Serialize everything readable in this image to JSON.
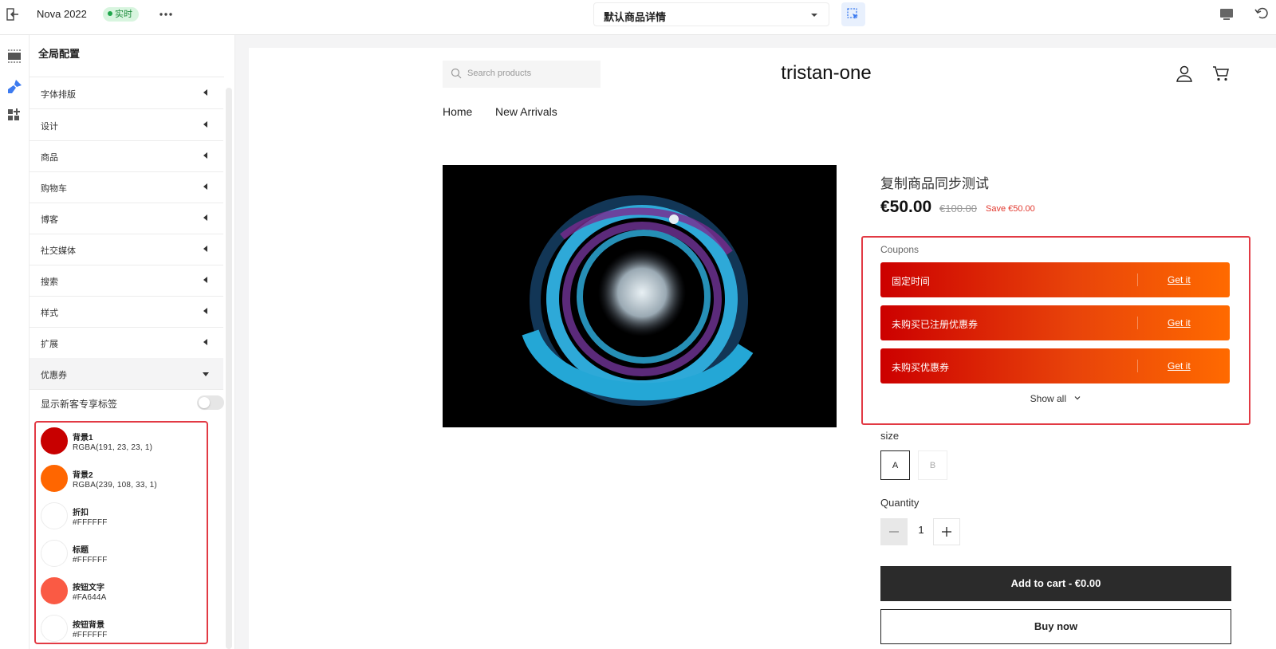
{
  "topbar": {
    "app_title": "Nova 2022",
    "live_badge": "实时",
    "page_select": "默认商品详情"
  },
  "panel": {
    "title": "全局配置",
    "sections": [
      {
        "label": "字体排版"
      },
      {
        "label": "设计"
      },
      {
        "label": "商品"
      },
      {
        "label": "购物车"
      },
      {
        "label": "博客"
      },
      {
        "label": "社交媒体"
      },
      {
        "label": "搜索"
      },
      {
        "label": "样式"
      },
      {
        "label": "扩展"
      },
      {
        "label": "优惠券"
      }
    ],
    "toggle_label": "显示新客专享标签",
    "toggle_on": false,
    "colors": [
      {
        "name": "背景1",
        "value": "RGBA(191, 23, 23, 1)",
        "hex": "#bf1717"
      },
      {
        "name": "背景2",
        "value": "RGBA(239, 108, 33, 1)",
        "hex": "#ef6c21"
      },
      {
        "name": "折扣",
        "value": "#FFFFFF",
        "hex": "#ffffff"
      },
      {
        "name": "标题",
        "value": "#FFFFFF",
        "hex": "#ffffff"
      },
      {
        "name": "按钮文字",
        "value": "#FA644A",
        "hex": "#fa644a"
      },
      {
        "name": "按钮背景",
        "value": "#FFFFFF",
        "hex": "#ffffff"
      }
    ]
  },
  "store": {
    "search_placeholder": "Search products",
    "brand": "tristan-one",
    "nav": [
      "Home",
      "New Arrivals"
    ],
    "product_title": "复制商品同步测试",
    "price": "€50.00",
    "price_old": "€100.00",
    "price_save": "Save €50.00",
    "coupons_label": "Coupons",
    "coupons": [
      {
        "title": "固定时间",
        "action": "Get it"
      },
      {
        "title": "未购买已注册优惠券",
        "action": "Get it"
      },
      {
        "title": "未购买优惠券",
        "action": "Get it"
      }
    ],
    "show_all": "Show all",
    "size_label": "size",
    "sizes": [
      "A",
      "B"
    ],
    "quantity_label": "Quantity",
    "quantity": "1",
    "add_to_cart": "Add to cart - €0.00",
    "buy_now": "Buy now"
  },
  "colors": {
    "accent_blue": "#3d7bf0",
    "live_green": "#1fa64b",
    "highlight_red": "#e23a44",
    "coupon_start": "#cc0000",
    "coupon_end": "#ff6a00"
  }
}
